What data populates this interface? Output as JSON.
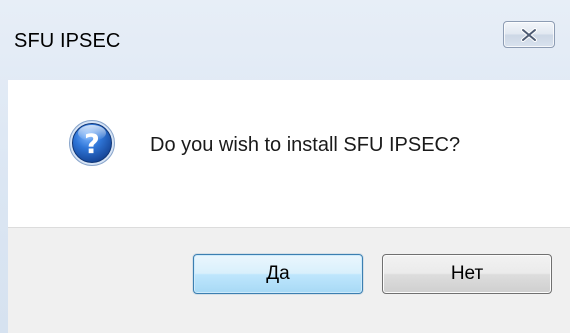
{
  "window": {
    "title": "SFU IPSEC"
  },
  "titlebar": {
    "close_icon": "close-icon"
  },
  "dialog": {
    "icon": "question-icon",
    "message": "Do you wish to install SFU IPSEC?"
  },
  "buttons": {
    "yes_label": "Да",
    "no_label": "Нет"
  },
  "colors": {
    "frame": "#dbe6f3",
    "content_bg": "#ffffff",
    "footer_bg": "#f0f0f0",
    "default_button_border": "#3c7fb1",
    "icon_blue": "#1e5bb8"
  }
}
